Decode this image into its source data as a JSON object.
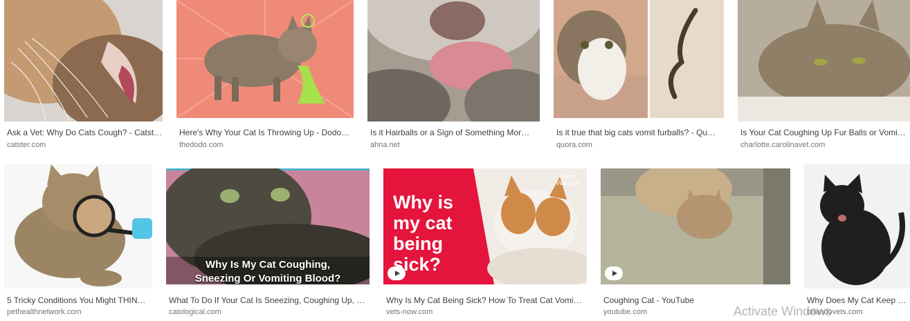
{
  "results": [
    {
      "caption": "Ask a Vet: Why Do Cats Cough? - Catst…",
      "source": "catster.com"
    },
    {
      "caption": "Here's Why Your Cat Is Throwing Up - Dodo…",
      "source": "thedodo.com"
    },
    {
      "caption": "Is it Hairballs or a Sign of Something Mor…",
      "source": "ahna.net"
    },
    {
      "caption": "Is it true that big cats vomit furballs? - Qu…",
      "source": "quora.com"
    },
    {
      "caption": "Is Your Cat Coughing Up Fur Balls or Vomi…",
      "source": "charlotte.carolinavet.com"
    },
    {
      "caption": "5 Tricky Conditions You Might THIN…",
      "source": "pethealthnetwork.com"
    },
    {
      "caption": "What To Do If Your Cat Is Sneezing, Coughing Up, …",
      "source": "catological.com",
      "overlay": "Why Is My Cat Coughing, Sneezing Or Vomiting Blood?"
    },
    {
      "caption": "Why Is My Cat Being Sick? How To Treat Cat Vomi…",
      "source": "vets-now.com",
      "overlay": "Why is my cat being sick?",
      "badge": "Video Vetsnow"
    },
    {
      "caption": "Coughing Cat - YouTube",
      "source": "youtube.com"
    },
    {
      "caption": "Why Does My Cat Keep …",
      "source": "orlandovets.com"
    }
  ],
  "watermark": "Activate Windows",
  "colors": {
    "caption": "#3c4043",
    "source": "#70757a",
    "vets_red": "#e4143c",
    "dodo_bg": "#f08a78"
  }
}
